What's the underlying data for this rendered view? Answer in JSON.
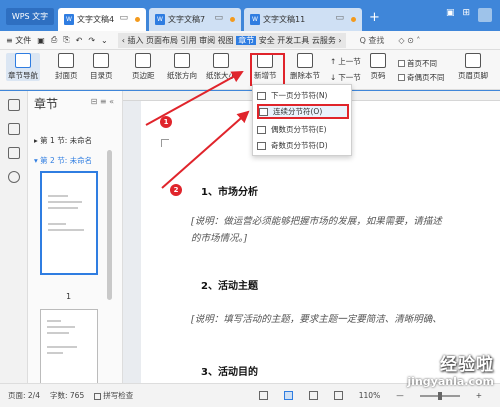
{
  "titlebar": {
    "wps_label": "WPS 文字",
    "tabs": [
      {
        "label": "文字文稿4",
        "active": true
      },
      {
        "label": "文字文稿7",
        "active": false
      },
      {
        "label": "文字文稿11",
        "active": false
      }
    ],
    "plus": "+"
  },
  "menubar": {
    "file": "≡ 文件",
    "ribbon_tabs_pre": "‹ 插入 页面布局 引用 审阅 视图 ",
    "ribbon_tabs_hl": "章节",
    "ribbon_tabs_post": " 安全 开发工具 云服务 ›",
    "search": "Q 查找",
    "right_items": "◇ ⊙ ˄"
  },
  "ribbon": {
    "chapter_nav": "章节导航",
    "cover": "封面页",
    "toc": "目录页",
    "margins": "页边距",
    "orientation": "纸张方向",
    "size": "纸张大小",
    "new_section": "新增节",
    "delete_section": "删除本节",
    "prev_section": "上一节",
    "next_section": "下一节",
    "page_number": "页码",
    "first_diff": "首页不同",
    "odd_even_diff": "奇偶页不同",
    "header_footer": "页眉页脚"
  },
  "dropdown": {
    "items": [
      {
        "label": "下一页分节符(N)"
      },
      {
        "label": "连续分节符(O)"
      },
      {
        "label": "偶数页分节符(E)"
      },
      {
        "label": "奇数页分节符(D)"
      }
    ]
  },
  "panel": {
    "title": "章节",
    "sections": [
      {
        "label": "第 1 节: 未命名",
        "selected": false
      },
      {
        "label": "第 2 节: 未命名",
        "selected": true
      }
    ],
    "page_label": "1"
  },
  "document": {
    "h1": "1、市场分析",
    "note1_line1": "[说明：做运营必须能够把握市场的发展，如果需要，请描述",
    "note1_line2": "的市场情况。]",
    "h2": "2、活动主题",
    "note2": "[说明：填写活动的主题，要求主题一定要简洁、清晰明确、",
    "h3": "3、活动目的"
  },
  "annotations": {
    "badge1": "1",
    "badge2": "2"
  },
  "statusbar": {
    "page": "页面: 2/4",
    "words": "字数: 765",
    "spell": "拼写检查",
    "zoom": "110%",
    "minus": "—",
    "plus": "+"
  },
  "watermark": {
    "big": "经验啦",
    "small": "jingyanla.com"
  },
  "colors": {
    "accent": "#2f7de1",
    "annotation_red": "#e0242b",
    "titlebar": "#3f86d9"
  }
}
